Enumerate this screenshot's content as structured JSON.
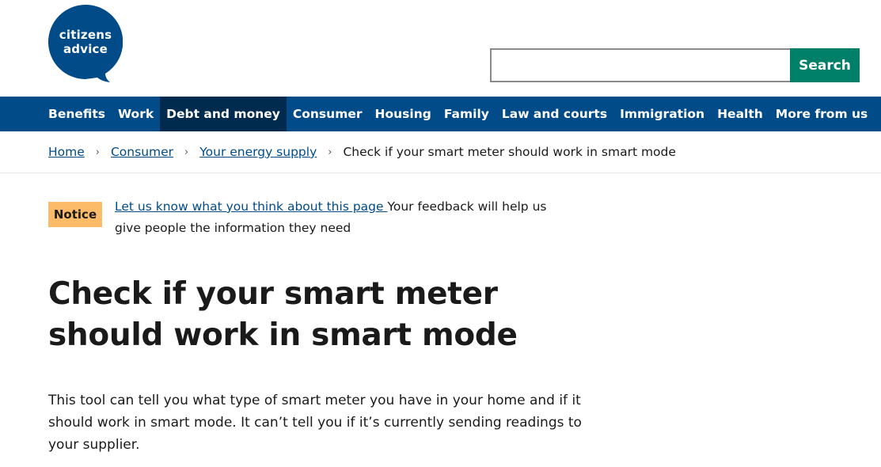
{
  "header": {
    "logo_line1": "citizens",
    "logo_line2": "advice",
    "search": {
      "value": "",
      "button_label": "Search"
    }
  },
  "colors": {
    "brand_blue": "#004b88",
    "nav_active": "#002b4e",
    "search_green": "#008069",
    "notice_orange": "#fcbb69"
  },
  "nav": {
    "items": [
      {
        "label": "Benefits"
      },
      {
        "label": "Work"
      },
      {
        "label": "Debt and money",
        "active": true
      },
      {
        "label": "Consumer"
      },
      {
        "label": "Housing"
      },
      {
        "label": "Family"
      },
      {
        "label": "Law and courts"
      },
      {
        "label": "Immigration"
      },
      {
        "label": "Health"
      },
      {
        "label": "More from us"
      }
    ]
  },
  "breadcrumb": {
    "items": [
      "Home",
      "Consumer",
      "Your energy supply"
    ],
    "separator": "›",
    "current": "Check if your smart meter should work in smart mode"
  },
  "notice": {
    "badge": "Notice",
    "link_text": "Let us know what you think about this page ",
    "text": "Your feedback will help us give people the information they need"
  },
  "main": {
    "title": "Check if your smart meter should work in smart mode",
    "intro": "This tool can tell you what type of smart meter you have in your home and if it should work in smart mode. It can’t tell you if it’s currently sending readings to your supplier."
  }
}
